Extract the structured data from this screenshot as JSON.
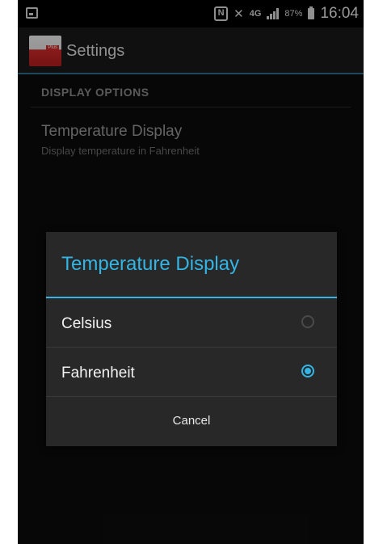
{
  "status_bar": {
    "network_label": "4G",
    "battery_percent": "87%",
    "time": "16:04",
    "icons": [
      "screenshot-icon",
      "nfc-icon",
      "mute-icon",
      "network-icon",
      "signal-icon",
      "battery-icon"
    ]
  },
  "action_bar": {
    "title": "Settings"
  },
  "settings": {
    "category": "DISPLAY OPTIONS",
    "item_title": "Temperature Display",
    "item_summary": "Display temperature in Fahrenheit"
  },
  "dialog": {
    "title": "Temperature Display",
    "options": [
      {
        "label": "Celsius",
        "selected": false
      },
      {
        "label": "Fahrenheit",
        "selected": true
      }
    ],
    "cancel_label": "Cancel",
    "accent_color": "#33b5e5"
  }
}
